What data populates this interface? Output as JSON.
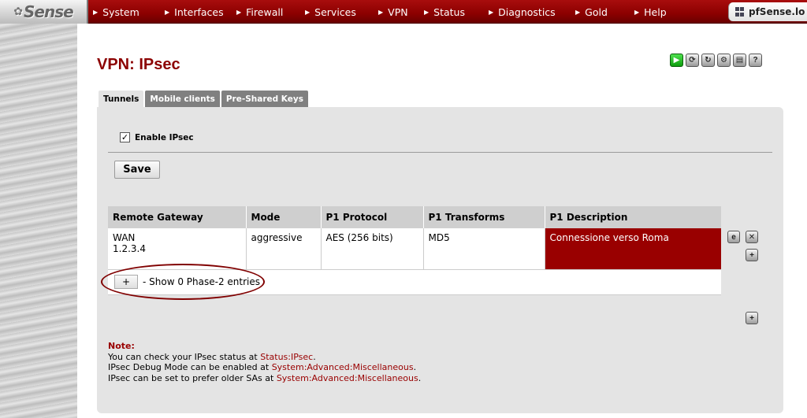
{
  "nav": {
    "logo": "Sense",
    "items": [
      "System",
      "Interfaces",
      "Firewall",
      "Services",
      "VPN",
      "Status",
      "Diagnostics",
      "Gold",
      "Help"
    ],
    "host": "pfSense.lo"
  },
  "page": {
    "title": "VPN: IPsec"
  },
  "tabs": [
    "Tunnels",
    "Mobile clients",
    "Pre-Shared Keys"
  ],
  "form": {
    "enable_label": "Enable IPsec",
    "enabled": true,
    "save_label": "Save"
  },
  "table": {
    "headers": [
      "Remote Gateway",
      "Mode",
      "P1 Protocol",
      "P1 Transforms",
      "P1 Description"
    ],
    "rows": [
      {
        "gateway": "WAN",
        "gateway_ip": "1.2.3.4",
        "mode": "aggressive",
        "protocol": "AES (256 bits)",
        "transforms": "MD5",
        "description": "Connessione verso Roma"
      }
    ],
    "phase2_button": "+",
    "phase2_text": "- Show 0 Phase-2 entries"
  },
  "note": {
    "title": "Note:",
    "line1_prefix": "You can check your IPsec status at ",
    "line1_link": "Status:IPsec",
    "line1_suffix": ".",
    "line2_prefix": "IPsec Debug Mode can be enabled at ",
    "line2_link": "System:Advanced:Miscellaneous",
    "line2_suffix": ".",
    "line3_prefix": "IPsec can be set to prefer older SAs at ",
    "line3_link": "System:Advanced:Miscellaneous",
    "line3_suffix": "."
  },
  "icons": {
    "toolbar": [
      "play-icon",
      "restart-icon",
      "reload-icon",
      "settings-icon",
      "log-icon",
      "help-icon"
    ],
    "row": [
      "edit-icon",
      "delete-icon",
      "add-phase-icon"
    ],
    "add": "add-tunnel-icon"
  },
  "colors": {
    "brand": "#8c0000",
    "description_bg": "#990000",
    "link": "#990000"
  }
}
